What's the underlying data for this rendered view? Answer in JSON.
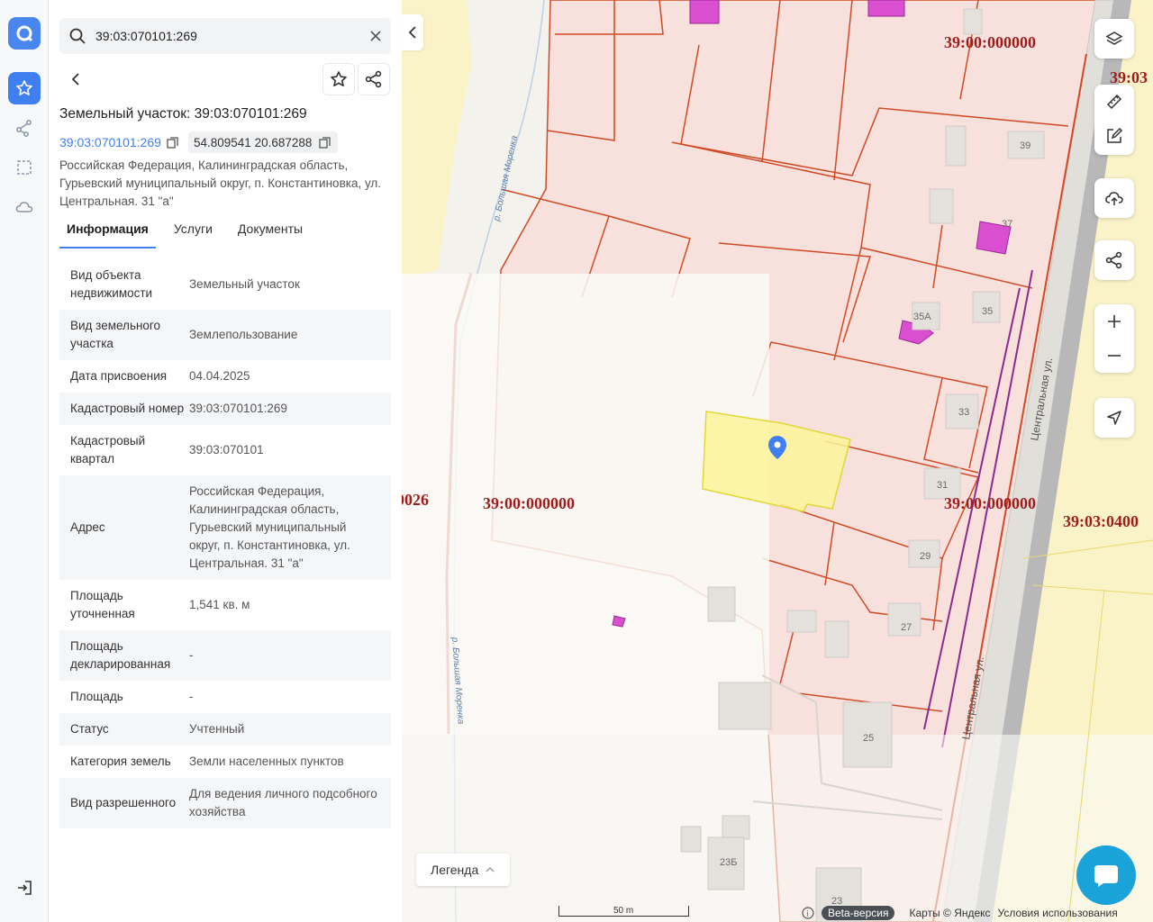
{
  "search": {
    "value": "39:03:070101:269"
  },
  "panel": {
    "title": "Земельный участок: 39:03:070101:269",
    "cadastral_link": "39:03:070101:269",
    "coordinates": "54.809541 20.687288",
    "address": "Российская Федерация, Калининградская область, Гурьевский муниципальный округ, п. Константиновка, ул. Центральная. 31 \"а\""
  },
  "tabs": [
    {
      "label": "Информация",
      "active": true
    },
    {
      "label": "Услуги",
      "active": false
    },
    {
      "label": "Документы",
      "active": false
    }
  ],
  "info": [
    {
      "key": "Вид объекта недвижимости",
      "value": "Земельный участок"
    },
    {
      "key": "Вид земельного участка",
      "value": "Землепользование"
    },
    {
      "key": "Дата присвоения",
      "value": "04.04.2025"
    },
    {
      "key": "Кадастровый номер",
      "value": "39:03:070101:269"
    },
    {
      "key": "Кадастровый квартал",
      "value": "39:03:070101"
    },
    {
      "key": "Адрес",
      "value": "Российская Федерация, Калининградская область, Гурьевский муниципальный округ, п. Константиновка, ул. Центральная. 31 \"а\""
    },
    {
      "key": "Площадь уточненная",
      "value": "1,541 кв. м"
    },
    {
      "key": "Площадь декларированная",
      "value": "-"
    },
    {
      "key": "Площадь",
      "value": "-"
    },
    {
      "key": "Статус",
      "value": "Учтенный"
    },
    {
      "key": "Категория земель",
      "value": "Земли населенных пунктов"
    },
    {
      "key": "Вид разрешенного",
      "value": "Для ведения личного подсобного хозяйства"
    }
  ],
  "map": {
    "quarter_labels": [
      "39:00:000000",
      "39:00:000000",
      "39:00:000000",
      "39:03:0400",
      "0026",
      "39:03"
    ],
    "house_numbers": [
      "39",
      "37",
      "35А",
      "35",
      "33",
      "31",
      "29",
      "27",
      "25",
      "23Б",
      "23"
    ],
    "streets": [
      "Центральная ул.",
      "Центральная ул."
    ],
    "river_labels": [
      "р. Большая Моренка",
      "р. Большая Моренка"
    ],
    "legend_label": "Легенда",
    "scale_label": "50 m",
    "beta_label": "Beta-версия",
    "copyright": "Карты © Яндекс",
    "terms": "Условия использования",
    "info_glyph": "i"
  },
  "colors": {
    "accent": "#3f7ff0",
    "parcel_fill": "#f8e1dc",
    "parcel_border": "#cf4a25",
    "selected_fill": "#fbf59a",
    "building_fill": "#d94fd0",
    "quarter_label": "#9e1c1c",
    "chat": "#1aa3d9"
  }
}
